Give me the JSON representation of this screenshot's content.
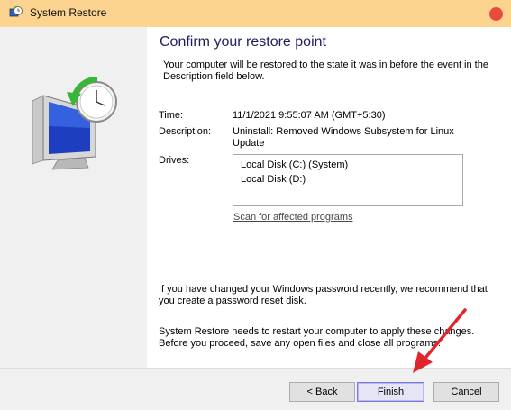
{
  "window": {
    "title": "System Restore"
  },
  "content": {
    "heading": "Confirm your restore point",
    "intro": "Your computer will be restored to the state it was in before the event in the Description field below.",
    "time_label": "Time:",
    "time_value": "11/1/2021 9:55:07 AM (GMT+5:30)",
    "description_label": "Description:",
    "description_value": "Uninstall: Removed Windows Subsystem for Linux Update",
    "drives_label": "Drives:",
    "drives": [
      "Local Disk (C:) (System)",
      "Local Disk (D:)"
    ],
    "scan_link": "Scan for affected programs",
    "password_note": "If you have changed your Windows password recently, we recommend that you create a password reset disk.",
    "restart_note": "System Restore needs to restart your computer to apply these changes. Before you proceed, save any open files and close all programs."
  },
  "buttons": {
    "back": "< Back",
    "finish": "Finish",
    "cancel": "Cancel"
  },
  "colors": {
    "titlebar": "#fcd48f",
    "close": "#e84a3e",
    "arrow": "#e2242c",
    "heading": "#1f1f5f"
  },
  "icons": {
    "title": "system-restore-icon",
    "hero": "monitor-clock-restore-icon"
  }
}
